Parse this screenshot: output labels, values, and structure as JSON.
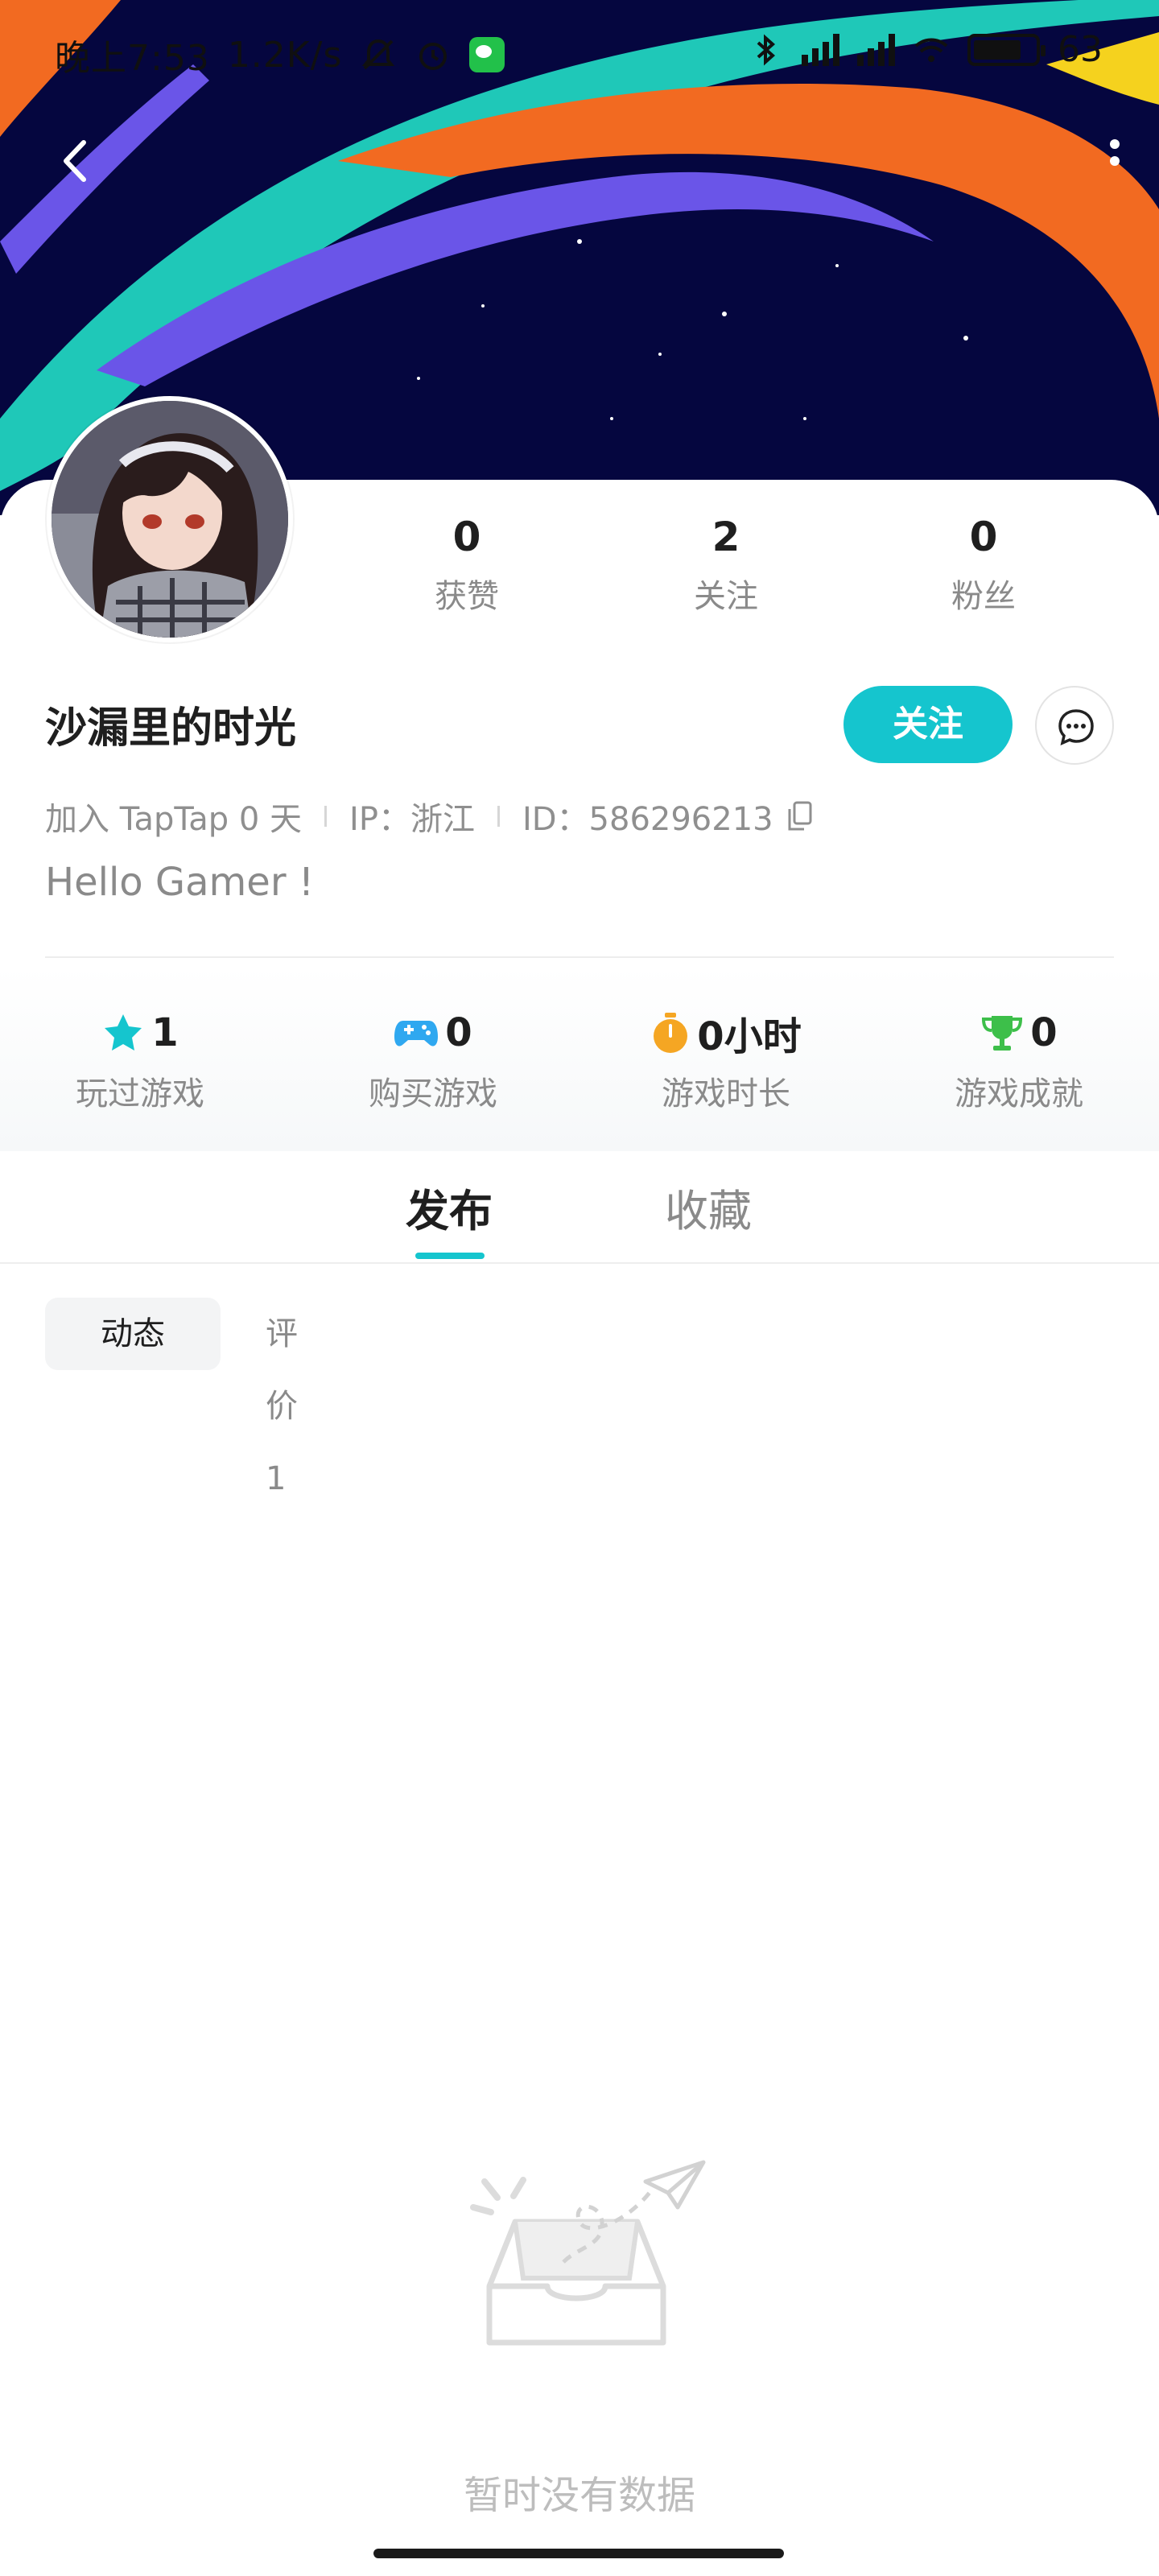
{
  "status_bar": {
    "time": "晚上7:53",
    "speed": "1.2K/s",
    "battery": "63"
  },
  "header": {
    "back_icon": "chevron-left-icon",
    "more_icon": "more-vertical-icon"
  },
  "profile": {
    "username": "沙漏里的时光",
    "follow_label": "关注",
    "message_icon": "chat-bubble-icon",
    "counts": [
      {
        "value": "0",
        "label": "获赞"
      },
      {
        "value": "2",
        "label": "关注"
      },
      {
        "value": "0",
        "label": "粉丝"
      }
    ],
    "meta": {
      "joined": "加入 TapTap 0 天",
      "ip": "IP：浙江",
      "id": "ID：586296213"
    },
    "bio": "Hello Gamer !"
  },
  "stats": [
    {
      "icon": "star-icon",
      "value": "1",
      "label": "玩过游戏",
      "color": "#15c5ce"
    },
    {
      "icon": "gamepad-icon",
      "value": "0",
      "label": "购买游戏",
      "color": "#2fa8f0"
    },
    {
      "icon": "stopwatch-icon",
      "value": "0小时",
      "label": "游戏时长",
      "color": "#f5a623"
    },
    {
      "icon": "trophy-icon",
      "value": "0",
      "label": "游戏成就",
      "color": "#3dbf4a"
    }
  ],
  "tabs": [
    {
      "label": "发布",
      "active": true
    },
    {
      "label": "收藏",
      "active": false
    }
  ],
  "subtabs": [
    {
      "label": "动态",
      "active": true
    },
    {
      "label": "评价 1",
      "active": false
    }
  ],
  "empty_state": {
    "icon": "empty-inbox-icon",
    "text": "暂时没有数据"
  },
  "colors": {
    "accent": "#15c5ce",
    "banner_bg": "#05063f",
    "banner_teal": "#1fc8b8",
    "banner_orange": "#f26a21",
    "banner_purple": "#6a55e8",
    "banner_yellow": "#f5d21e"
  }
}
